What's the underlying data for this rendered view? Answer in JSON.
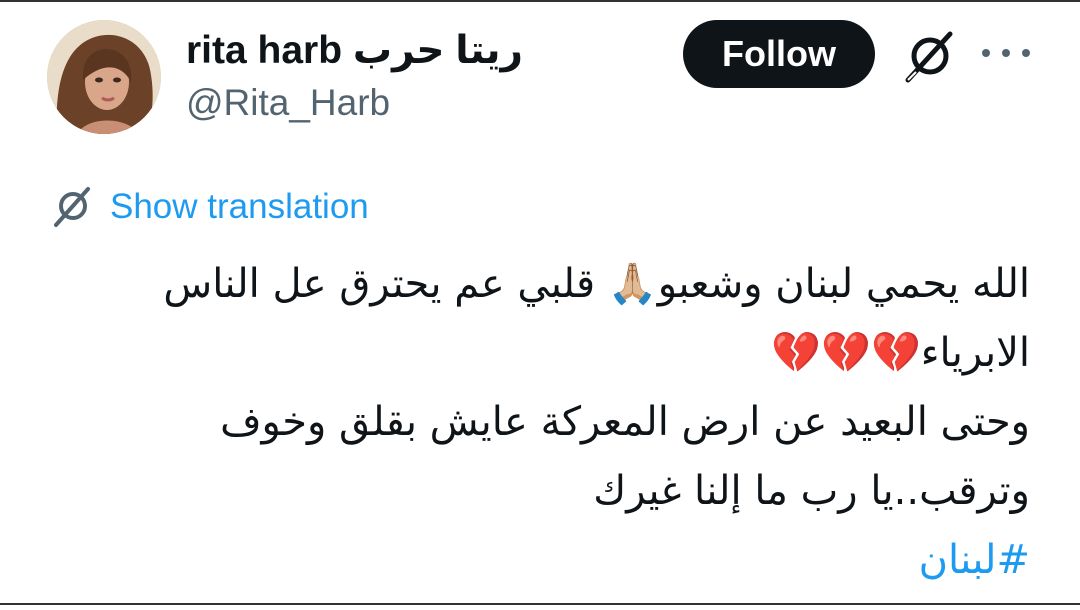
{
  "author": {
    "display_name": "rita harb ريتا حرب",
    "handle": "@Rita_Harb"
  },
  "actions": {
    "follow_label": "Follow",
    "grok_icon": "grok-icon",
    "more_icon": "more-icon"
  },
  "translation": {
    "label": "Show translation"
  },
  "tweet": {
    "line1": "الله يحمي لبنان وشعبو🙏🏼 قلبي عم يحترق عل الناس",
    "line2": "الابرياء💔💔💔",
    "line3": "وحتى البعيد عن ارض المعركة عايش بقلق وخوف",
    "line4": "وترقب..يا رب ما إلنا غيرك",
    "hashtag": "#لبنان"
  },
  "colors": {
    "text": "#0f1419",
    "secondary": "#536471",
    "link": "#1d9bf0",
    "button_bg": "#0f1419",
    "button_text": "#ffffff"
  }
}
